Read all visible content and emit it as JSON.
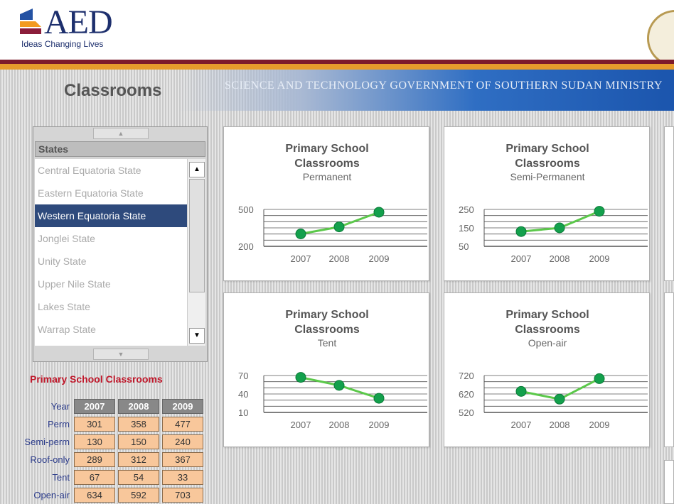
{
  "header": {
    "logo_text": "AED",
    "tagline": "Ideas Changing Lives",
    "banner_text": "SCIENCE AND TECHNOLOGY  GOVERNMENT OF SOUTHERN SUDAN MINISTRY"
  },
  "page": {
    "title": "Classrooms"
  },
  "states": {
    "header": "States",
    "items": [
      "Central Equatoria State",
      "Eastern Equatoria State",
      "Western Equatoria State",
      "Jonglei State",
      "Unity State",
      "Upper Nile State",
      "Lakes State",
      "Warrap State"
    ],
    "selected_index": 2
  },
  "table": {
    "title": "Primary School Classrooms",
    "corner": "Year",
    "years": [
      "2007",
      "2008",
      "2009"
    ],
    "rows": [
      {
        "label": "Perm",
        "values": [
          "301",
          "358",
          "477"
        ]
      },
      {
        "label": "Semi-perm",
        "values": [
          "130",
          "150",
          "240"
        ]
      },
      {
        "label": "Roof-only",
        "values": [
          "289",
          "312",
          "367"
        ]
      },
      {
        "label": "Tent",
        "values": [
          "67",
          "54",
          "33"
        ]
      },
      {
        "label": "Open-air",
        "values": [
          "634",
          "592",
          "703"
        ]
      }
    ]
  },
  "colors": {
    "line": "#5bc84a",
    "point": "#13a04c",
    "selected": "#2e4a7c",
    "table_title": "#c0172a"
  },
  "chart_data": [
    {
      "type": "line",
      "title": "Primary School Classrooms",
      "subtitle": "Permanent",
      "categories": [
        "2007",
        "2008",
        "2009"
      ],
      "values": [
        301,
        358,
        477
      ],
      "y_ticks": [
        "500",
        "200"
      ],
      "ylim": [
        200,
        500
      ]
    },
    {
      "type": "line",
      "title": "Primary School Classrooms",
      "subtitle": "Semi-Permanent",
      "categories": [
        "2007",
        "2008",
        "2009"
      ],
      "values": [
        130,
        150,
        240
      ],
      "y_ticks": [
        "250",
        "150",
        "50"
      ],
      "ylim": [
        50,
        250
      ]
    },
    {
      "type": "line",
      "title": "Primary School Classrooms",
      "subtitle": "Tent",
      "categories": [
        "2007",
        "2008",
        "2009"
      ],
      "values": [
        67,
        54,
        33
      ],
      "y_ticks": [
        "70",
        "40",
        "10"
      ],
      "ylim": [
        10,
        70
      ]
    },
    {
      "type": "line",
      "title": "Primary School Classrooms",
      "subtitle": "Open-air",
      "categories": [
        "2007",
        "2008",
        "2009"
      ],
      "values": [
        634,
        592,
        703
      ],
      "y_ticks": [
        "720",
        "620",
        "520"
      ],
      "ylim": [
        520,
        720
      ]
    }
  ]
}
